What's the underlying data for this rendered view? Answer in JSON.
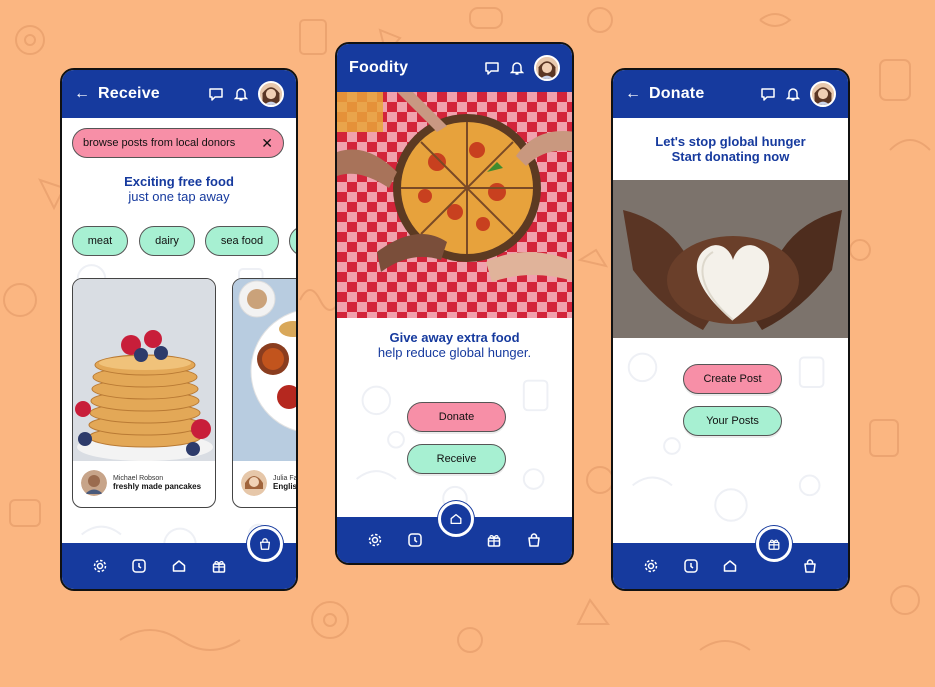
{
  "colors": {
    "background": "#fbb681",
    "brand_blue": "#163a9e",
    "pink": "#f78fa7",
    "mint": "#a7f0d2"
  },
  "receive_screen": {
    "title": "Receive",
    "back_icon": "arrow-left-icon",
    "search": {
      "value": "browse posts from local donors",
      "clear_icon": "close-icon"
    },
    "headline": "Exciting free food",
    "subheadline": "just one tap away",
    "chips": [
      "meat",
      "dairy",
      "sea food"
    ],
    "cards": [
      {
        "author": "Michael Robson",
        "description": "freshly made pancakes"
      },
      {
        "author": "Julia Fa",
        "description": "Englis"
      }
    ]
  },
  "home_screen": {
    "title": "Foodity",
    "headline": "Give away extra food",
    "subheadline": "help reduce global hunger.",
    "buttons": {
      "donate": "Donate",
      "receive": "Receive"
    }
  },
  "donate_screen": {
    "title": "Donate",
    "headline_line1": "Let's stop global hunger",
    "headline_line2": "Start donating now",
    "buttons": {
      "create_post": "Create Post",
      "your_posts": "Your Posts"
    }
  },
  "top_icons": [
    "chat-icon",
    "bell-icon",
    "avatar"
  ],
  "bottom_nav_icons": [
    "settings-icon",
    "clock-icon",
    "home-icon",
    "gift-icon",
    "bag-icon"
  ]
}
